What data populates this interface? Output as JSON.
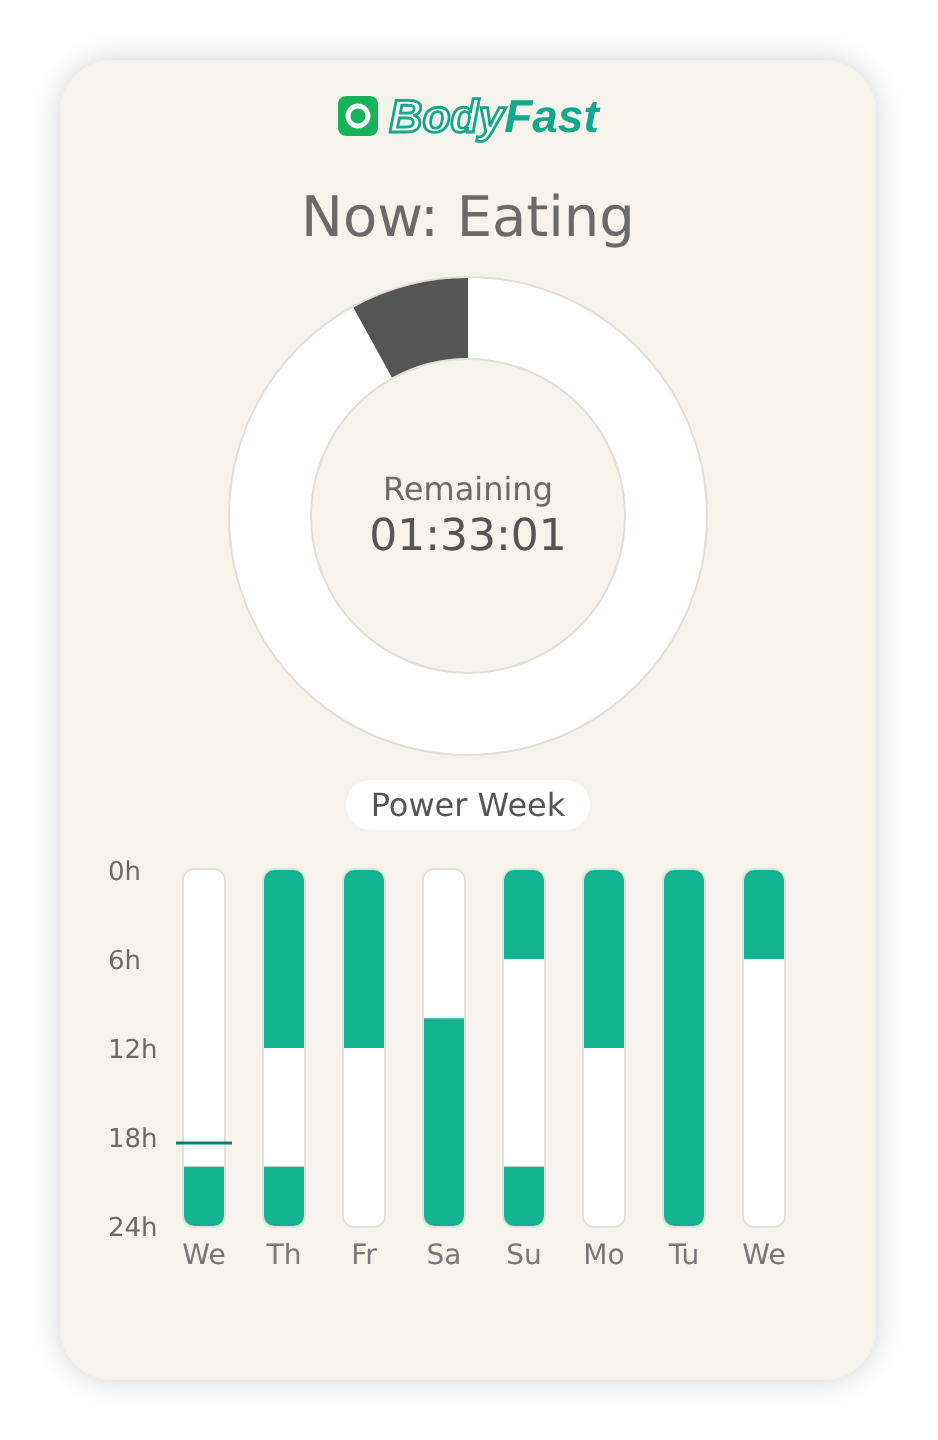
{
  "logo": {
    "text": "Body**Fast**"
  },
  "status": {
    "title": "Now: Eating",
    "label": "Remaining",
    "time": "01:33:01"
  },
  "power_week": {
    "title": "Power Week",
    "chart_data": {
      "type": "bar",
      "stacked": true,
      "orientation": "vertical",
      "categories": [
        "We",
        "Th",
        "Fr",
        "Sa",
        "Su",
        "Mo",
        "Tu",
        "We"
      ],
      "ylim": [
        24,
        0
      ],
      "yticks": [
        {
          "value": 0,
          "label": "0h"
        },
        {
          "value": 6,
          "label": "6h"
        },
        {
          "value": 12,
          "label": "12h"
        },
        {
          "value": 18,
          "label": "18h"
        },
        {
          "value": 24,
          "label": "24h"
        }
      ],
      "series": [
        {
          "color": "#12b391",
          "values": [
            0,
            12,
            12,
            0,
            6,
            12,
            24,
            6
          ]
        },
        {
          "color": "#ffffff",
          "values": [
            20,
            8,
            12,
            10,
            14,
            12,
            0,
            18
          ]
        },
        {
          "color": "#12b391",
          "values": [
            4,
            4,
            0,
            14,
            4,
            0,
            0,
            0
          ]
        }
      ]
    }
  }
}
